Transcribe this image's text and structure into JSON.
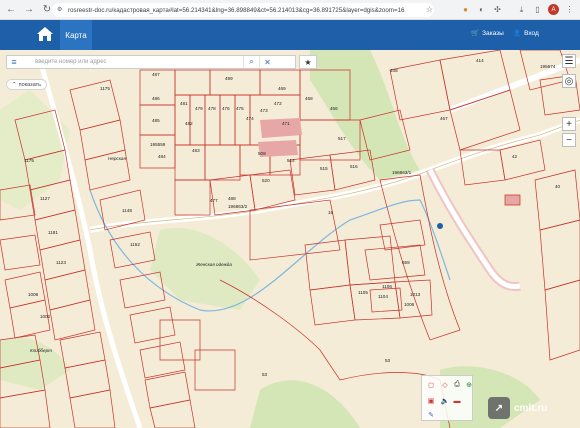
{
  "browser": {
    "url": "rosreestr-doc.ru/кадастровая_карта#lat=56.214341&lng=36.898849&ct=56.214013&cg=36.891725&layer=dgis&zoom=16",
    "profile_initial": "A"
  },
  "header": {
    "tab_label": "Карта",
    "orders_label": "Заказы",
    "login_label": "Вход"
  },
  "search": {
    "placeholder": "введите номер или адрес",
    "value": ""
  },
  "show_button": "показать",
  "map": {
    "parcel_labels": [
      "487",
      "486",
      "485",
      "484",
      "499",
      "469",
      "468",
      "466",
      "517",
      "515",
      "516",
      "520",
      "509",
      "514",
      "477",
      "488",
      "483",
      "482",
      "481",
      "479",
      "478",
      "476",
      "475",
      "474",
      "473",
      "472",
      "471",
      "467",
      "408",
      "414",
      "195674",
      "195559",
      "196863/1",
      "196863/2",
      "15",
      "53",
      "53",
      "659",
      "1104",
      "1013",
      "1006",
      "1106",
      "1105",
      "42",
      "40",
      "1175",
      "1127",
      "1181",
      "1123",
      "1175",
      "1148",
      "1152",
      "1006",
      "1002"
    ],
    "place_labels": [
      "Женская одежда",
      "Клибберт",
      "Нерская"
    ]
  },
  "colors": {
    "header": "#1d5fa8",
    "tab_active": "#2c74c2",
    "parcel_stroke": "#c9302c",
    "map_bg": "#f4ecd6",
    "greenery": "#d4e6b5",
    "road": "#ffffff",
    "river": "#7fb7e0"
  },
  "watermark": "cmlt.ru"
}
